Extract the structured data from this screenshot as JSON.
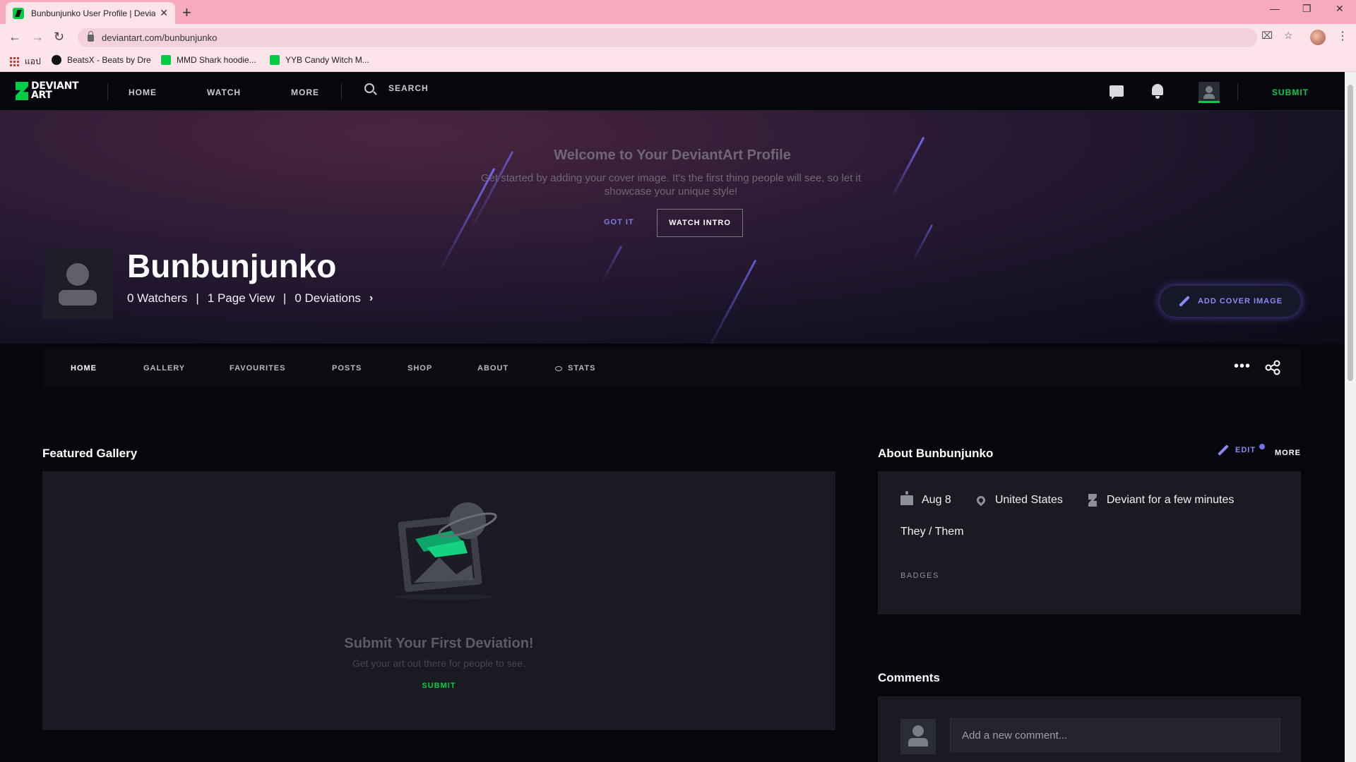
{
  "browser": {
    "tab_title": "Bunbunjunko User Profile | DeviantArt",
    "url": "deviantart.com/bunbunjunko",
    "bookmarks": [
      {
        "label": "แอป"
      },
      {
        "label": "BeatsX - Beats by Dre"
      },
      {
        "label": "MMD Shark hoodie..."
      },
      {
        "label": "YYB Candy Witch M..."
      }
    ]
  },
  "header": {
    "logo_line1": "DEVIANT",
    "logo_line2": "ART",
    "nav": [
      "HOME",
      "WATCH",
      "MORE"
    ],
    "search_label": "SEARCH",
    "submit_label": "SUBMIT"
  },
  "hero": {
    "welcome_title": "Welcome to Your DeviantArt Profile",
    "welcome_sub": "Get started by adding your cover image. It's the first thing people will see, so let it showcase your unique style!",
    "got_it": "GOT IT",
    "watch_intro": "WATCH INTRO",
    "username": "Bunbunjunko",
    "watchers": "0 Watchers",
    "page_views": "1 Page View",
    "deviations": "0 Deviations",
    "add_cover": "ADD COVER IMAGE"
  },
  "tabs": [
    "HOME",
    "GALLERY",
    "FAVOURITES",
    "POSTS",
    "SHOP",
    "ABOUT",
    "STATS"
  ],
  "featured": {
    "title": "Featured Gallery",
    "empty_title": "Submit Your First Deviation!",
    "empty_sub": "Get your art out there for people to see.",
    "submit": "SUBMIT"
  },
  "about": {
    "title": "About Bunbunjunko",
    "edit": "EDIT",
    "more": "MORE",
    "birthday": "Aug 8",
    "location": "United States",
    "member": "Deviant for a few minutes",
    "pronouns": "They / Them",
    "badges": "BADGES"
  },
  "comments": {
    "title": "Comments",
    "placeholder": "Add a new comment..."
  },
  "colors": {
    "brand_green": "#05cc47",
    "accent_purple": "#8b89f5",
    "tab_pink": "#f7a9be"
  }
}
